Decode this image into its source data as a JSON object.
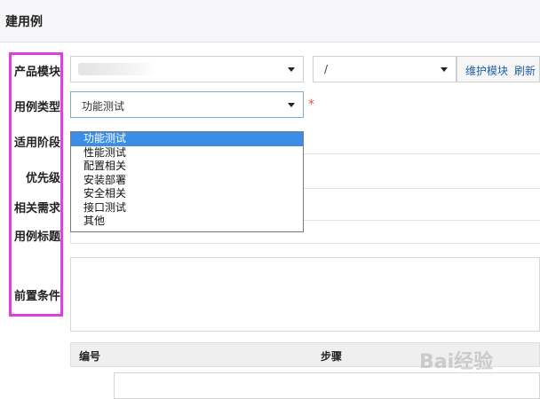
{
  "page": {
    "title": "建用例"
  },
  "form": {
    "labels": {
      "product_module": "产品模块",
      "case_type": "用例类型",
      "stage": "适用阶段",
      "priority": "优先级",
      "related_story": "相关需求",
      "case_title": "用例标题",
      "precondition": "前置条件"
    },
    "module_path": "/",
    "maintain_module_link": "维护模块",
    "refresh_link": "刷新",
    "case_type_value": "功能测试",
    "required_marker": "*",
    "case_type_options": [
      "功能测试",
      "性能测试",
      "配置相关",
      "安装部署",
      "安全相关",
      "接口测试",
      "其他"
    ]
  },
  "steps_table": {
    "col_number": "编号",
    "col_steps": "步骤"
  },
  "watermark": "Bai经验"
}
